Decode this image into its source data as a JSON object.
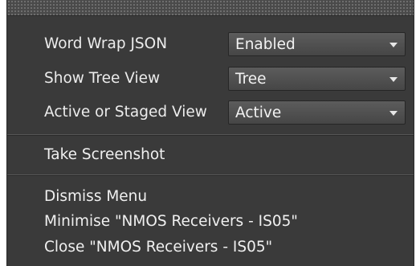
{
  "settings": [
    {
      "label": "Word Wrap JSON",
      "value": "Enabled"
    },
    {
      "label": "Show Tree View",
      "value": "Tree"
    },
    {
      "label": "Active or Staged View",
      "value": "Active"
    }
  ],
  "actions": {
    "take_screenshot": "Take Screenshot",
    "dismiss_menu": "Dismiss Menu",
    "minimise": "Minimise \"NMOS Receivers - IS05\"",
    "close": "Close \"NMOS Receivers - IS05\""
  },
  "colors": {
    "menu_background": "#3a3a3a",
    "text": "#ececec",
    "select_background": "#505050"
  }
}
